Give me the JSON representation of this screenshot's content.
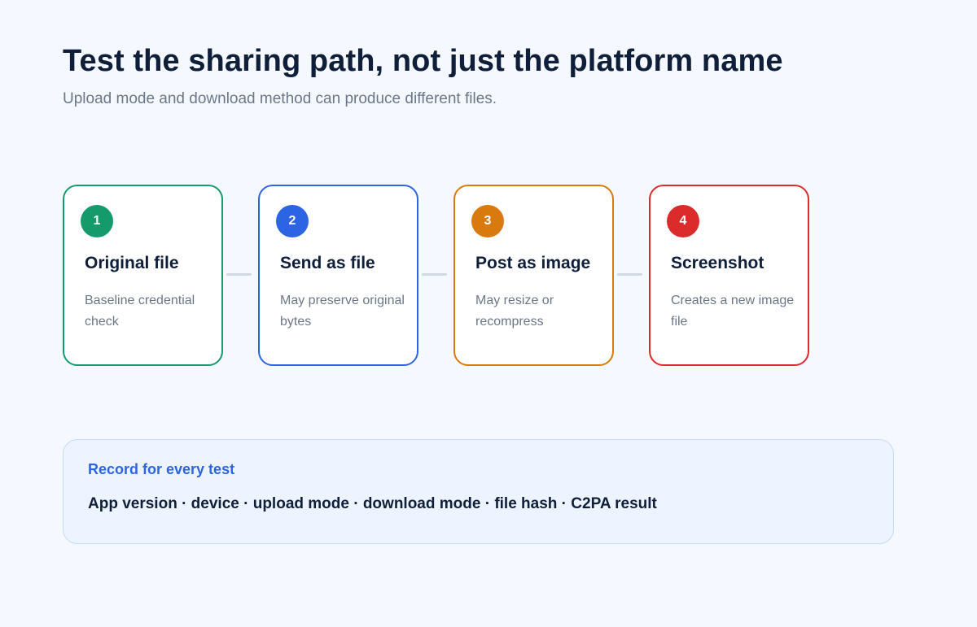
{
  "header": {
    "title": "Test the sharing path, not just the platform name",
    "subtitle": "Upload mode and download method can produce different files."
  },
  "steps": [
    {
      "number": "1",
      "title": "Original file",
      "description": "Baseline credential check",
      "color": "#159a6b"
    },
    {
      "number": "2",
      "title": "Send as file",
      "description": "May preserve original bytes",
      "color": "#2c64e3"
    },
    {
      "number": "3",
      "title": "Post as image",
      "description": "May resize or recompress",
      "color": "#d97a0e"
    },
    {
      "number": "4",
      "title": "Screenshot",
      "description": "Creates a new image file",
      "color": "#dc2b2b"
    }
  ],
  "record": {
    "heading": "Record for every test",
    "items": "App version · device · upload mode · download mode · file hash · C2PA result"
  }
}
